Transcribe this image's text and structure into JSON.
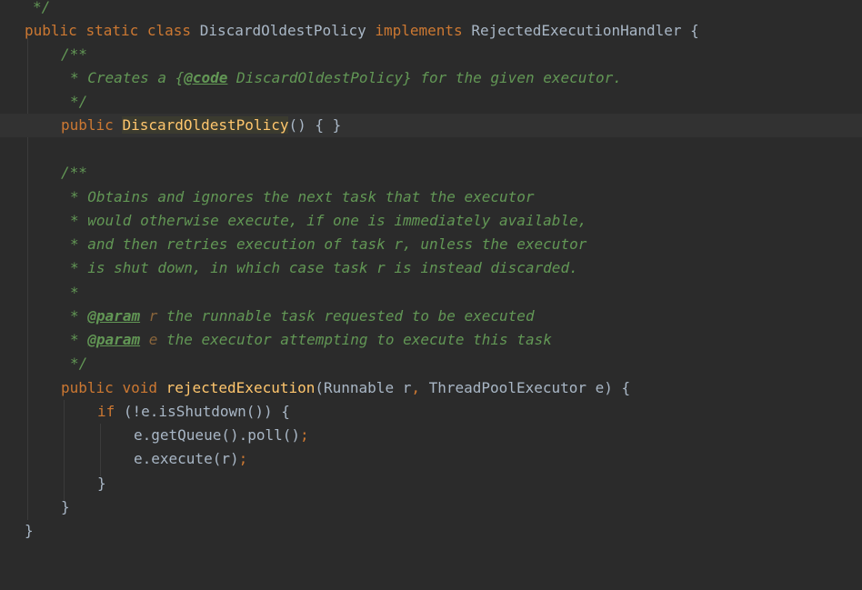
{
  "editor": {
    "lines": {
      "l0": {
        "comment_end": "*/"
      },
      "l1": {
        "kw_public": "public",
        "kw_static": "static",
        "kw_class": "class",
        "class_name": "DiscardOldestPolicy",
        "kw_implements": "implements",
        "iface": "RejectedExecutionHandler",
        "brace": "{"
      },
      "l2": {
        "doc_open": "/**"
      },
      "l3": {
        "star": "*",
        "text1": "Creates a ",
        "brace_open": "{",
        "code_tag": "@code",
        "code_text": " DiscardOldestPolicy",
        "brace_close": "}",
        "text2": " for the given executor."
      },
      "l4": {
        "doc_close": "*/"
      },
      "l5": {
        "kw_public": "public",
        "ctor_name": "DiscardOldestPolicy",
        "rest": "() { }"
      },
      "l6": {
        "doc_open": "/**"
      },
      "l7": {
        "text": "* Obtains and ignores the next task that the executor"
      },
      "l8": {
        "text": "* would otherwise execute, if one is immediately available,"
      },
      "l9": {
        "text": "* and then retries execution of task r, unless the executor"
      },
      "l10": {
        "text": "* is shut down, in which case task r is instead discarded."
      },
      "l11": {
        "text": "*"
      },
      "l12": {
        "star": "*",
        "param_tag": "@param",
        "param_name": "r",
        "text": " the runnable task requested to be executed"
      },
      "l13": {
        "star": "*",
        "param_tag": "@param",
        "param_name": "e",
        "text": " the executor attempting to execute this task"
      },
      "l14": {
        "doc_close": "*/"
      },
      "l15": {
        "kw_public": "public",
        "kw_void": "void",
        "method_name": "rejectedExecution",
        "params1": "(Runnable r",
        "comma": ",",
        "params2": " ThreadPoolExecutor e) {"
      },
      "l16": {
        "kw_if": "if",
        "cond": " (!e.isShutdown()) {"
      },
      "l17": {
        "stmt": "e.getQueue().poll()",
        "semi": ";"
      },
      "l18": {
        "stmt": "e.execute(r)",
        "semi": ";"
      },
      "l19": {
        "brace": "}"
      },
      "l20": {
        "brace": "}"
      },
      "l21": {
        "brace": "}"
      }
    }
  },
  "colors": {
    "background": "#2b2b2b",
    "current_line": "#323232",
    "keyword": "#cc7832",
    "identifier": "#a9b7c6",
    "doc_comment": "#629755",
    "method_decl": "#ffc66d",
    "param_ref": "#8a653b"
  }
}
